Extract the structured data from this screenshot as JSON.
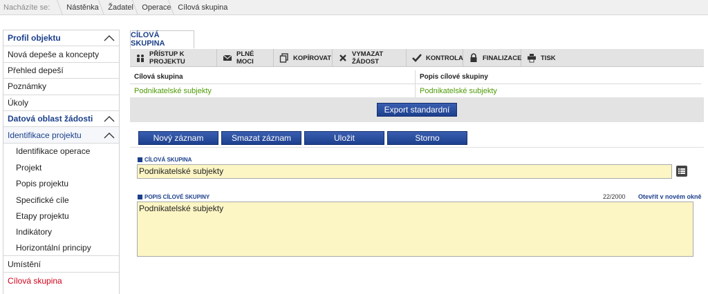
{
  "breadcrumb": {
    "label": "Nacházíte se:",
    "items": [
      "Nástěnka",
      "Žadatel",
      "Operace",
      "Cílová skupina"
    ]
  },
  "sidebar": {
    "items": [
      {
        "label": "Profil objektu"
      },
      {
        "label": "Nová depeše a koncepty"
      },
      {
        "label": "Přehled depeší"
      },
      {
        "label": "Poznámky"
      },
      {
        "label": "Úkoly"
      },
      {
        "label": "Datová oblast žádosti"
      },
      {
        "label": "Identifikace projektu"
      },
      {
        "label": "Identifikace operace"
      },
      {
        "label": "Projekt"
      },
      {
        "label": "Popis projektu"
      },
      {
        "label": "Specifické cíle"
      },
      {
        "label": "Etapy projektu"
      },
      {
        "label": "Indikátory"
      },
      {
        "label": "Horizontální principy"
      },
      {
        "label": "Umístění"
      },
      {
        "label": "Cílová skupina"
      }
    ]
  },
  "tab": {
    "label": "CÍLOVÁ SKUPINA"
  },
  "toolbar": {
    "items": [
      {
        "label": "PŘÍSTUP K PROJEKTU",
        "icon": "people-icon"
      },
      {
        "label": "PLNÉ MOCI",
        "icon": "envelope-icon"
      },
      {
        "label": "KOPÍROVAT",
        "icon": "copy-icon"
      },
      {
        "label": "VYMAZAT ŽÁDOST",
        "icon": "x-icon"
      },
      {
        "label": "KONTROLA",
        "icon": "check-icon"
      },
      {
        "label": "FINALIZACE",
        "icon": "lock-icon"
      },
      {
        "label": "TISK",
        "icon": "printer-icon"
      }
    ]
  },
  "grid": {
    "headers": [
      "Cílová skupina",
      "Popis cílové skupiny"
    ],
    "rows": [
      [
        "Podnikatelské subjekty",
        "Podnikatelské subjekty"
      ]
    ]
  },
  "buttons": {
    "export": "Export standardní",
    "new": "Nový záznam",
    "delete": "Smazat záznam",
    "save": "Uložit",
    "cancel": "Storno"
  },
  "form": {
    "group_label": "CÍLOVÁ SKUPINA",
    "group_value": "Podnikatelské subjekty",
    "desc_label": "POPIS CÍLOVÉ SKUPINY",
    "desc_value": "Podnikatelské subjekty",
    "desc_counter": "22/2000",
    "open_new_window": "Otevřít v novém okně"
  },
  "colors": {
    "accent": "#1b3f8b",
    "active": "#d0021b",
    "grid_value": "#4e9a06",
    "input_bg": "#fcf5c4"
  }
}
